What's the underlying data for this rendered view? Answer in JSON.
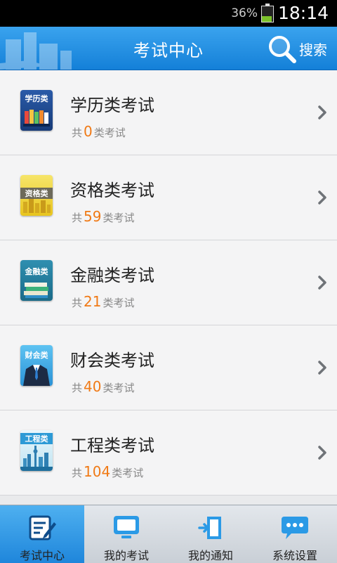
{
  "status_bar": {
    "battery_percent": "36%",
    "time": "18:14",
    "battery_level": 0.36
  },
  "header": {
    "title": "考试中心",
    "search_label": "搜索"
  },
  "categories": [
    {
      "tag": "学历类",
      "name": "学历类考试",
      "prefix": "共",
      "count": "0",
      "suffix": "类考试",
      "icon": "books-icon"
    },
    {
      "tag": "资格类",
      "name": "资格类考试",
      "prefix": "共",
      "count": "59",
      "suffix": "类考试",
      "icon": "city-icon"
    },
    {
      "tag": "金融类",
      "name": "金融类考试",
      "prefix": "共",
      "count": "21",
      "suffix": "类考试",
      "icon": "book-stack-icon"
    },
    {
      "tag": "财会类",
      "name": "财会类考试",
      "prefix": "共",
      "count": "40",
      "suffix": "类考试",
      "icon": "suit-icon"
    },
    {
      "tag": "工程类",
      "name": "工程类考试",
      "prefix": "共",
      "count": "104",
      "suffix": "类考试",
      "icon": "skyline-icon"
    }
  ],
  "tabs": [
    {
      "label": "考试中心",
      "icon": "exam-center-icon",
      "active": true
    },
    {
      "label": "我的考试",
      "icon": "monitor-icon",
      "active": false
    },
    {
      "label": "我的通知",
      "icon": "notification-icon",
      "active": false
    },
    {
      "label": "系统设置",
      "icon": "chat-settings-icon",
      "active": false
    }
  ],
  "colors": {
    "header": "#1e8fe3",
    "count": "#f07a16",
    "active_tab": "#2d95e2"
  }
}
